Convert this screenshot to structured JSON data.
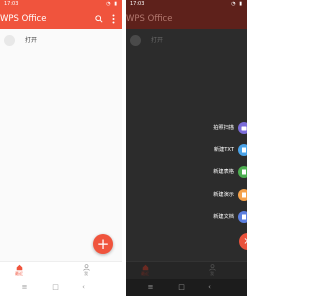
{
  "status": {
    "time": "17:03"
  },
  "app": {
    "title": "WPS Office"
  },
  "list": {
    "open_label": "打开"
  },
  "bottom_nav": {
    "home_label": "最近",
    "mine_label": "我"
  },
  "speed_dial": [
    {
      "label": "拍照扫描",
      "color": "#7b6cd9",
      "icon": "camera-icon"
    },
    {
      "label": "新建TXT",
      "color": "#4aa3e8",
      "icon": "text-file-icon"
    },
    {
      "label": "新建表格",
      "color": "#4caf50",
      "icon": "spreadsheet-icon"
    },
    {
      "label": "新建演示",
      "color": "#f5a24b",
      "icon": "presentation-icon"
    },
    {
      "label": "新建文档",
      "color": "#5b7fe0",
      "icon": "document-icon"
    }
  ],
  "colors": {
    "accent": "#f0543d",
    "dim_appbar": "#5e211b"
  }
}
